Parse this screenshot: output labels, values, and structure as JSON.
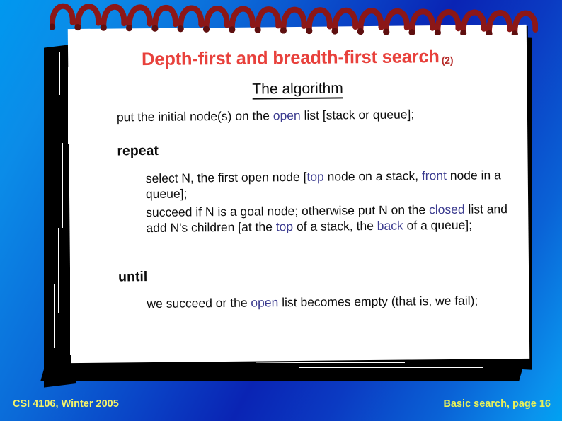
{
  "slide": {
    "title": "Depth-first and breadth-first search",
    "title_suffix": "(2)",
    "subtitle": "The algorithm",
    "title_color": "#e8413c",
    "suffix_color": "#b52b28",
    "highlight_color": "#3b3b8f",
    "body_color": "#0d0d0d",
    "paper_color": "#ffffff",
    "spiral_color": "#8c1717",
    "background_from": "#00a2f2",
    "background_to": "#0a24b4"
  },
  "algorithm": {
    "line_put": [
      {
        "text": "put the initial node(s) on the ",
        "style": "plain"
      },
      {
        "text": "open",
        "style": "highlight"
      },
      {
        "text": " list [stack or queue];",
        "style": "plain"
      }
    ],
    "keyword_repeat": "repeat",
    "line_select": [
      {
        "text": "select N, the first open node [",
        "style": "plain"
      },
      {
        "text": "top",
        "style": "highlight"
      },
      {
        "text": " node on a stack, ",
        "style": "plain"
      },
      {
        "text": "front",
        "style": "highlight"
      },
      {
        "text": " node in a queue];",
        "style": "plain"
      }
    ],
    "line_succeed": [
      {
        "text": "succeed if N is a goal node; otherwise put N on the ",
        "style": "plain"
      },
      {
        "text": "closed",
        "style": "highlight"
      },
      {
        "text": " list and add N's children [at the ",
        "style": "plain"
      },
      {
        "text": "top",
        "style": "highlight"
      },
      {
        "text": " of a stack, the ",
        "style": "plain"
      },
      {
        "text": "back",
        "style": "highlight"
      },
      {
        "text": " of a queue];",
        "style": "plain"
      }
    ],
    "keyword_until": "until",
    "line_we": [
      {
        "text": "we succeed or the ",
        "style": "plain"
      },
      {
        "text": "open",
        "style": "highlight"
      },
      {
        "text": " list becomes empty (that is, we fail);",
        "style": "plain"
      }
    ]
  },
  "footer": {
    "left": "CSI 4106, Winter 2005",
    "right": "Basic search, page 16",
    "color": "#f2f26a"
  },
  "decor": {
    "spiral_icon": "spiral-binding-icon",
    "spiral_ring_count": 19,
    "page_stack_icon": "paper-stack-edge-icon"
  }
}
